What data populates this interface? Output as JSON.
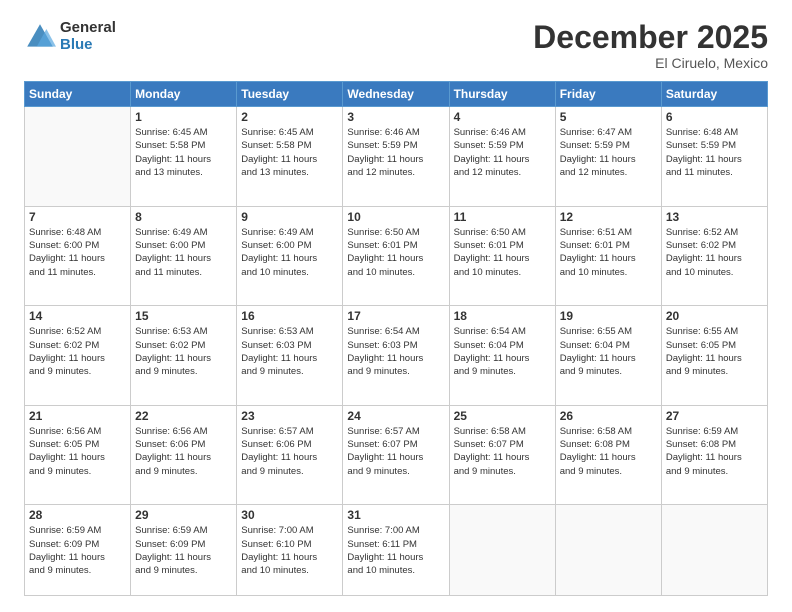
{
  "logo": {
    "general": "General",
    "blue": "Blue"
  },
  "header": {
    "month": "December 2025",
    "location": "El Ciruelo, Mexico"
  },
  "weekdays": [
    "Sunday",
    "Monday",
    "Tuesday",
    "Wednesday",
    "Thursday",
    "Friday",
    "Saturday"
  ],
  "weeks": [
    [
      {
        "day": "",
        "info": ""
      },
      {
        "day": "1",
        "info": "Sunrise: 6:45 AM\nSunset: 5:58 PM\nDaylight: 11 hours\nand 13 minutes."
      },
      {
        "day": "2",
        "info": "Sunrise: 6:45 AM\nSunset: 5:58 PM\nDaylight: 11 hours\nand 13 minutes."
      },
      {
        "day": "3",
        "info": "Sunrise: 6:46 AM\nSunset: 5:59 PM\nDaylight: 11 hours\nand 12 minutes."
      },
      {
        "day": "4",
        "info": "Sunrise: 6:46 AM\nSunset: 5:59 PM\nDaylight: 11 hours\nand 12 minutes."
      },
      {
        "day": "5",
        "info": "Sunrise: 6:47 AM\nSunset: 5:59 PM\nDaylight: 11 hours\nand 12 minutes."
      },
      {
        "day": "6",
        "info": "Sunrise: 6:48 AM\nSunset: 5:59 PM\nDaylight: 11 hours\nand 11 minutes."
      }
    ],
    [
      {
        "day": "7",
        "info": "Sunrise: 6:48 AM\nSunset: 6:00 PM\nDaylight: 11 hours\nand 11 minutes."
      },
      {
        "day": "8",
        "info": "Sunrise: 6:49 AM\nSunset: 6:00 PM\nDaylight: 11 hours\nand 11 minutes."
      },
      {
        "day": "9",
        "info": "Sunrise: 6:49 AM\nSunset: 6:00 PM\nDaylight: 11 hours\nand 10 minutes."
      },
      {
        "day": "10",
        "info": "Sunrise: 6:50 AM\nSunset: 6:01 PM\nDaylight: 11 hours\nand 10 minutes."
      },
      {
        "day": "11",
        "info": "Sunrise: 6:50 AM\nSunset: 6:01 PM\nDaylight: 11 hours\nand 10 minutes."
      },
      {
        "day": "12",
        "info": "Sunrise: 6:51 AM\nSunset: 6:01 PM\nDaylight: 11 hours\nand 10 minutes."
      },
      {
        "day": "13",
        "info": "Sunrise: 6:52 AM\nSunset: 6:02 PM\nDaylight: 11 hours\nand 10 minutes."
      }
    ],
    [
      {
        "day": "14",
        "info": "Sunrise: 6:52 AM\nSunset: 6:02 PM\nDaylight: 11 hours\nand 9 minutes."
      },
      {
        "day": "15",
        "info": "Sunrise: 6:53 AM\nSunset: 6:02 PM\nDaylight: 11 hours\nand 9 minutes."
      },
      {
        "day": "16",
        "info": "Sunrise: 6:53 AM\nSunset: 6:03 PM\nDaylight: 11 hours\nand 9 minutes."
      },
      {
        "day": "17",
        "info": "Sunrise: 6:54 AM\nSunset: 6:03 PM\nDaylight: 11 hours\nand 9 minutes."
      },
      {
        "day": "18",
        "info": "Sunrise: 6:54 AM\nSunset: 6:04 PM\nDaylight: 11 hours\nand 9 minutes."
      },
      {
        "day": "19",
        "info": "Sunrise: 6:55 AM\nSunset: 6:04 PM\nDaylight: 11 hours\nand 9 minutes."
      },
      {
        "day": "20",
        "info": "Sunrise: 6:55 AM\nSunset: 6:05 PM\nDaylight: 11 hours\nand 9 minutes."
      }
    ],
    [
      {
        "day": "21",
        "info": "Sunrise: 6:56 AM\nSunset: 6:05 PM\nDaylight: 11 hours\nand 9 minutes."
      },
      {
        "day": "22",
        "info": "Sunrise: 6:56 AM\nSunset: 6:06 PM\nDaylight: 11 hours\nand 9 minutes."
      },
      {
        "day": "23",
        "info": "Sunrise: 6:57 AM\nSunset: 6:06 PM\nDaylight: 11 hours\nand 9 minutes."
      },
      {
        "day": "24",
        "info": "Sunrise: 6:57 AM\nSunset: 6:07 PM\nDaylight: 11 hours\nand 9 minutes."
      },
      {
        "day": "25",
        "info": "Sunrise: 6:58 AM\nSunset: 6:07 PM\nDaylight: 11 hours\nand 9 minutes."
      },
      {
        "day": "26",
        "info": "Sunrise: 6:58 AM\nSunset: 6:08 PM\nDaylight: 11 hours\nand 9 minutes."
      },
      {
        "day": "27",
        "info": "Sunrise: 6:59 AM\nSunset: 6:08 PM\nDaylight: 11 hours\nand 9 minutes."
      }
    ],
    [
      {
        "day": "28",
        "info": "Sunrise: 6:59 AM\nSunset: 6:09 PM\nDaylight: 11 hours\nand 9 minutes."
      },
      {
        "day": "29",
        "info": "Sunrise: 6:59 AM\nSunset: 6:09 PM\nDaylight: 11 hours\nand 9 minutes."
      },
      {
        "day": "30",
        "info": "Sunrise: 7:00 AM\nSunset: 6:10 PM\nDaylight: 11 hours\nand 10 minutes."
      },
      {
        "day": "31",
        "info": "Sunrise: 7:00 AM\nSunset: 6:11 PM\nDaylight: 11 hours\nand 10 minutes."
      },
      {
        "day": "",
        "info": ""
      },
      {
        "day": "",
        "info": ""
      },
      {
        "day": "",
        "info": ""
      }
    ]
  ]
}
